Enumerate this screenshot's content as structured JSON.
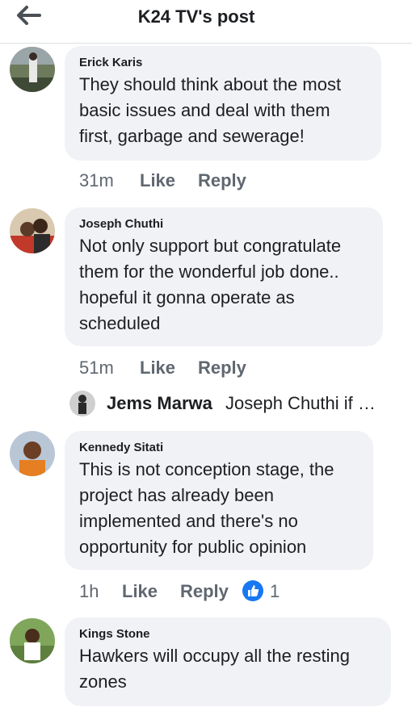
{
  "header": {
    "title": "K24 TV's post",
    "back_icon": "arrow-left-icon"
  },
  "comments": [
    {
      "author": "Erick Karis",
      "lines": [
        "They should think about the most",
        "basic issues and deal with them",
        "first, garbage and sewerage!"
      ],
      "time": "31m",
      "like": "Like",
      "reply": "Reply"
    },
    {
      "author": "Joseph Chuthi",
      "lines": [
        "Not only support but congratulate",
        "them for the wonderful job done..",
        "hopeful it gonna operate as",
        "scheduled"
      ],
      "time": "51m",
      "like": "Like",
      "reply": "Reply"
    },
    {
      "author": "Kennedy Sitati",
      "lines": [
        "This is not conception stage, the",
        "project has already been",
        "implemented and there's no",
        "opportunity for public opinion"
      ],
      "time": "1h",
      "like": "Like",
      "reply": "Reply",
      "reaction_count": "1"
    },
    {
      "author": "Kings Stone",
      "lines": [
        "Hawkers will occupy all the resting",
        "zones"
      ]
    }
  ],
  "reply_preview": {
    "author": "Jems Marwa",
    "snippet": "Joseph Chuthi if …"
  },
  "colors": {
    "bubble": "#f0f2f5",
    "meta_text": "#606770",
    "like_blue": "#1877f2"
  }
}
